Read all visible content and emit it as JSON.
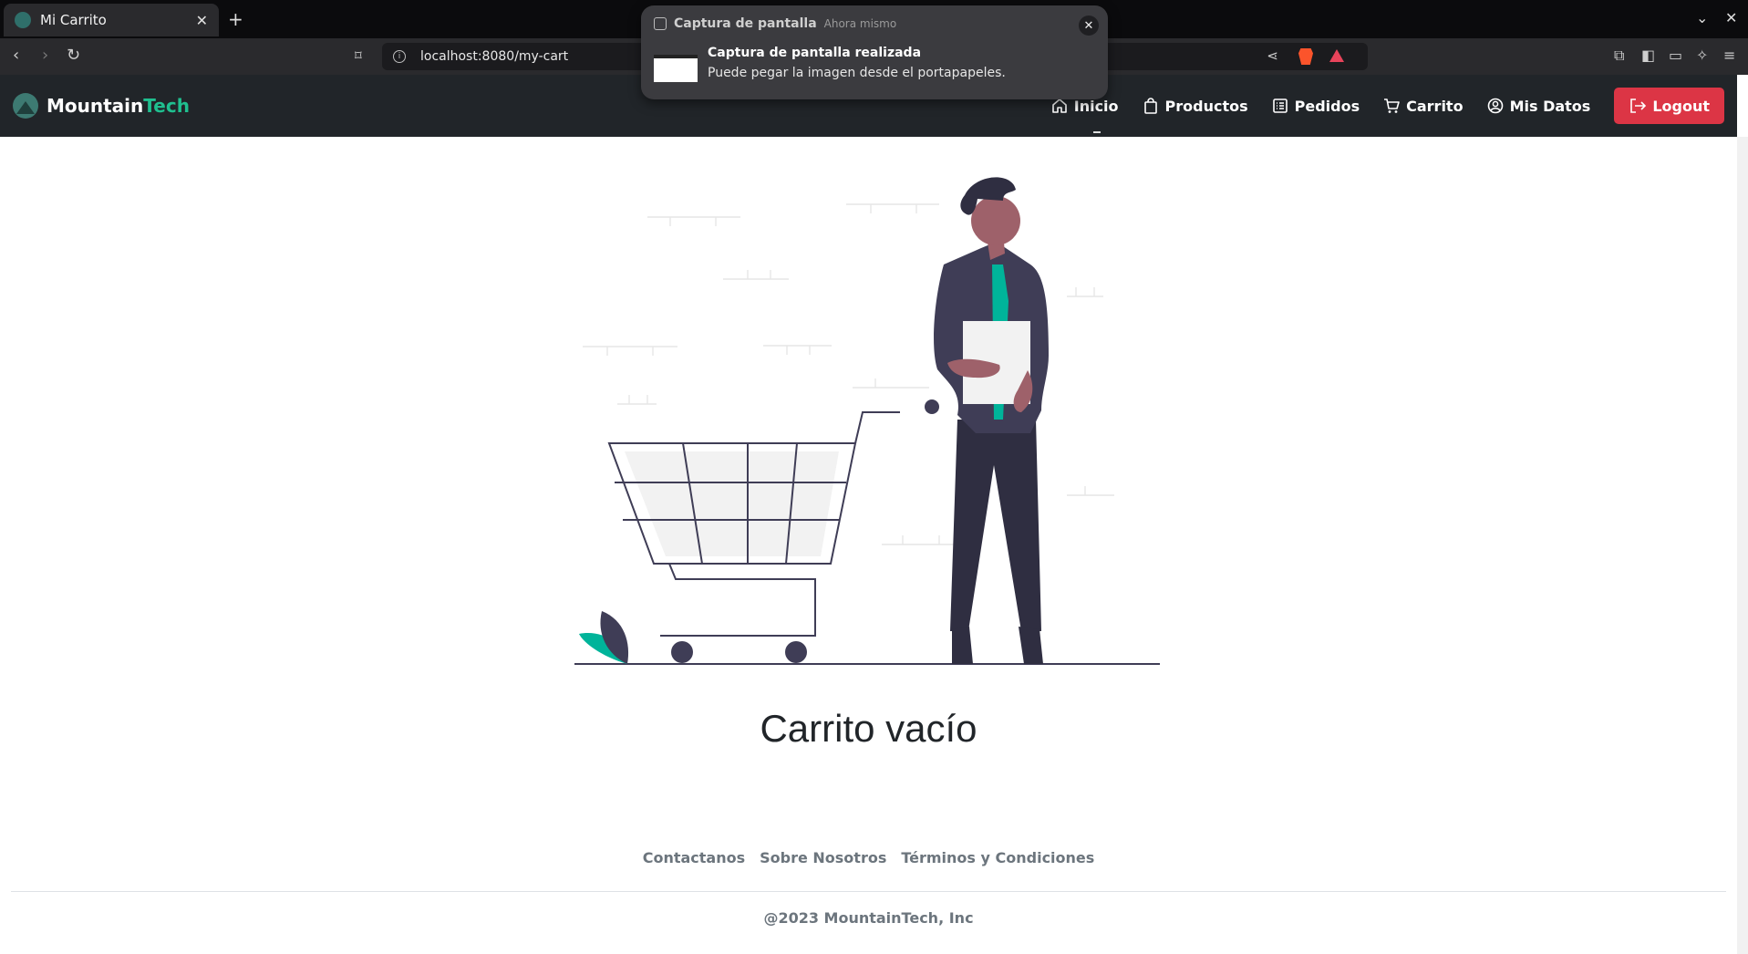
{
  "browser": {
    "tab_title": "Mi Carrito",
    "url": "localhost:8080/my-cart"
  },
  "notification": {
    "app": "Captura de pantalla",
    "time": "Ahora mismo",
    "title": "Captura de pantalla realizada",
    "body": "Puede pegar la imagen desde el portapapeles."
  },
  "navbar": {
    "brand_first": "Mountain",
    "brand_second": "Tech",
    "links": [
      {
        "label": "Inicio",
        "icon": "home-icon"
      },
      {
        "label": "Productos",
        "icon": "bag-icon"
      },
      {
        "label": "Pedidos",
        "icon": "list-icon"
      },
      {
        "label": "Carrito",
        "icon": "cart-icon"
      },
      {
        "label": "Mis Datos",
        "icon": "user-circle-icon"
      }
    ],
    "logout_label": "Logout"
  },
  "main": {
    "empty_title": "Carrito vacío"
  },
  "footer": {
    "links": [
      "Contactanos",
      "Sobre Nosotros",
      "Términos y Condiciones"
    ],
    "copyright": "@2023 MountainTech, Inc"
  },
  "colors": {
    "navbar_bg": "#212529",
    "brand_accent": "#1fbf8f",
    "logout_bg": "#dc3545",
    "illustration_dark": "#3f3d56",
    "illustration_teal": "#00b49a"
  }
}
